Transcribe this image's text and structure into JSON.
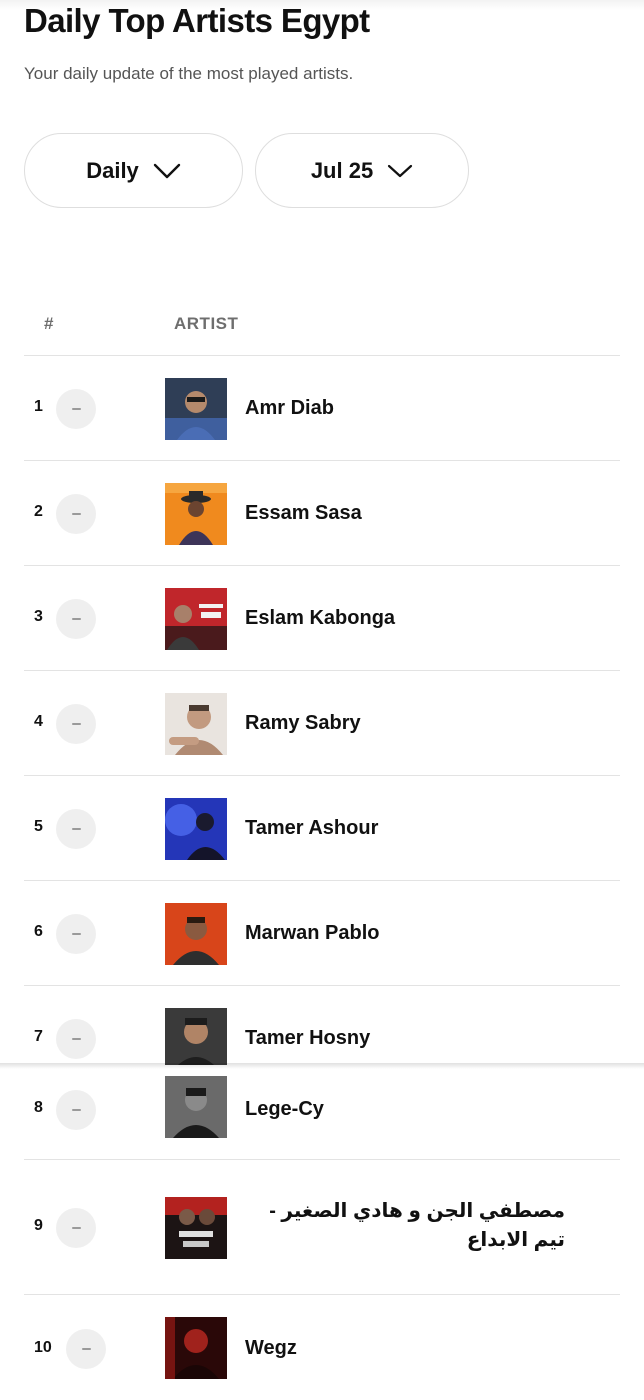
{
  "header": {
    "title": "Daily Top Artists Egypt",
    "subtitle": "Your daily update of the most played artists."
  },
  "filters": {
    "period": "Daily",
    "date": "Jul 25"
  },
  "table": {
    "columns": [
      "#",
      "ARTIST"
    ],
    "rows": [
      {
        "rank": "1",
        "artist": "Amr Diab"
      },
      {
        "rank": "2",
        "artist": "Essam Sasa"
      },
      {
        "rank": "3",
        "artist": "Eslam Kabonga"
      },
      {
        "rank": "4",
        "artist": "Ramy Sabry"
      },
      {
        "rank": "5",
        "artist": "Tamer Ashour"
      },
      {
        "rank": "6",
        "artist": "Marwan Pablo"
      },
      {
        "rank": "7",
        "artist": "Tamer Hosny"
      },
      {
        "rank": "8",
        "artist": "Lege-Cy"
      },
      {
        "rank": "9",
        "artist": "مصطفي الجن و هادي الصغير - تيم الابداع"
      },
      {
        "rank": "10",
        "artist": "Wegz"
      }
    ]
  },
  "icons": {
    "dropdown": "chevron-down-icon",
    "trend": "no-change-dash-icon"
  }
}
